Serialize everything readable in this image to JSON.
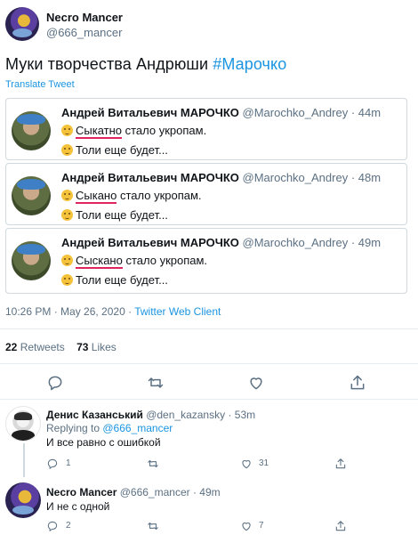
{
  "author": {
    "name": "Necro Mancer",
    "handle": "@666_mancer"
  },
  "tweet": {
    "text_plain": "Муки творчества Андрюши ",
    "hashtag": "#Марочко",
    "translate": "Translate Tweet",
    "time": "10:26 PM · May 26, 2020 · ",
    "client": "Twitter Web Client"
  },
  "quotes": [
    {
      "name": "Андрей Витальевич МАРОЧКО",
      "handle": "@Marochko_Andrey",
      "time": "· 44m",
      "word": "Сыкатно",
      "rest": " стало укропам.",
      "line2": "Толи еще будет..."
    },
    {
      "name": "Андрей Витальевич МАРОЧКО",
      "handle": "@Marochko_Andrey",
      "time": "· 48m",
      "word": "Сыкано",
      "rest": " стало укропам.",
      "line2": "Толи еще будет..."
    },
    {
      "name": "Андрей Витальевич МАРОЧКО",
      "handle": "@Marochko_Andrey",
      "time": "· 49m",
      "word": "Сыскано",
      "rest": " стало укропам.",
      "line2": "Толи еще будет..."
    }
  ],
  "stats": {
    "retweets": "22",
    "retweets_label": "Retweets",
    "likes": "73",
    "likes_label": "Likes"
  },
  "replies": [
    {
      "name": "Денис Казанський",
      "handle": "@den_kazansky",
      "time": "· 53m",
      "replying": "Replying to ",
      "replying_to": "@666_mancer",
      "text": "И все равно с ошибкой",
      "replies": "1",
      "likes": "31"
    },
    {
      "name": "Necro Mancer",
      "handle": "@666_mancer",
      "time": "· 49m",
      "text": "И не с одной",
      "replies": "2",
      "likes": "7"
    }
  ],
  "icons": [
    "reply-icon",
    "retweet-icon",
    "like-icon",
    "share-icon"
  ],
  "colors": {
    "link": "#1b95e0",
    "muted": "#5b7083",
    "underline": "#e0245e"
  }
}
